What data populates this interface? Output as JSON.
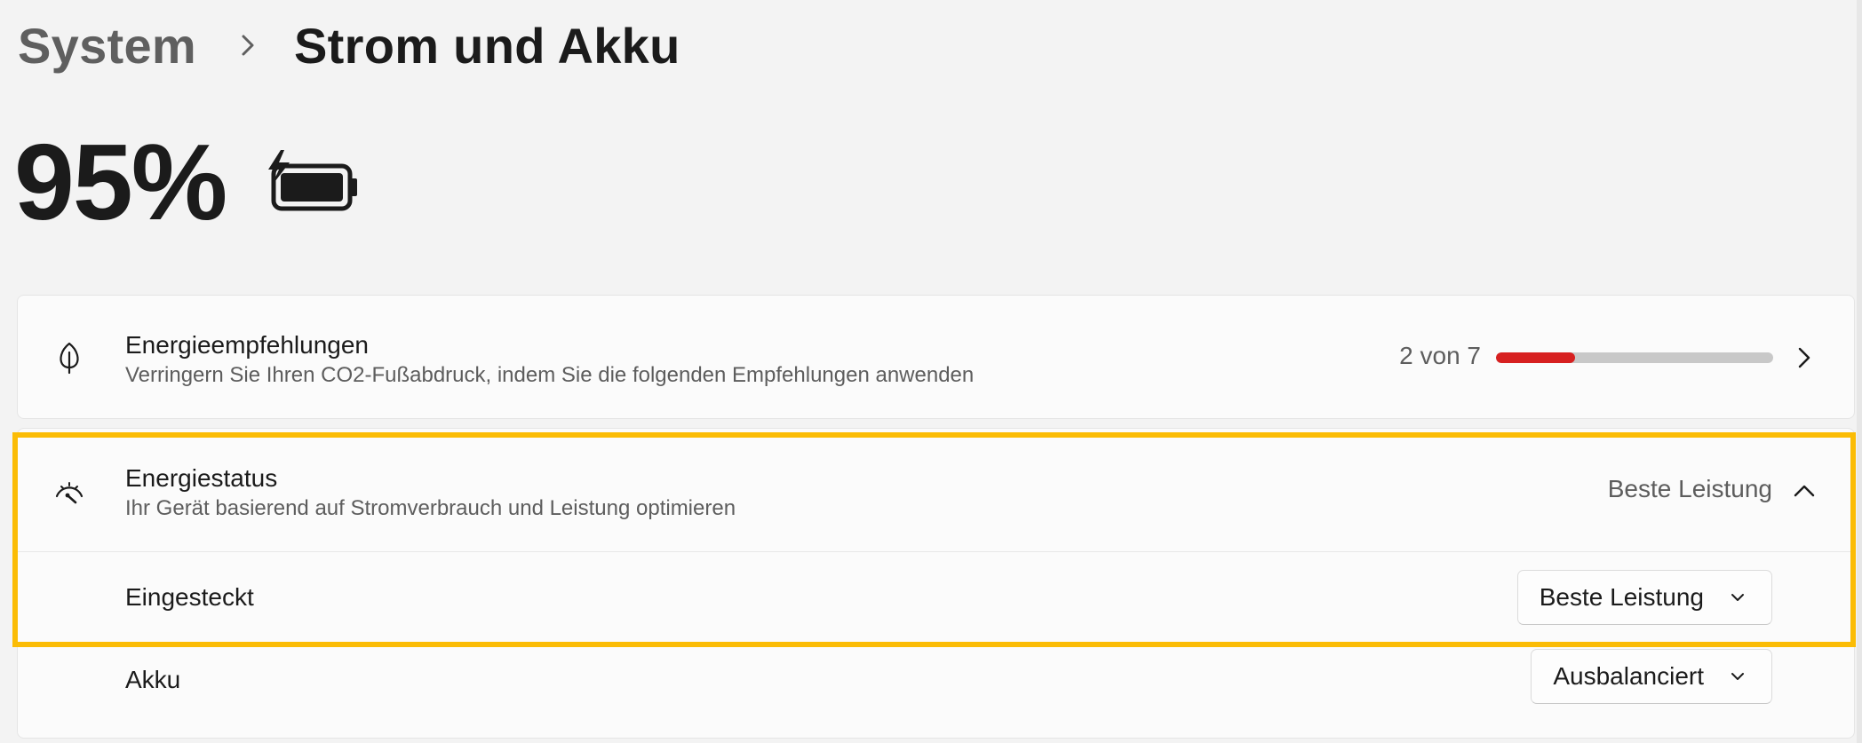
{
  "breadcrumb": {
    "root": "System",
    "current": "Strom und Akku"
  },
  "battery": {
    "percent_text": "95%",
    "charging": true,
    "icon": "battery-charging-icon"
  },
  "recommendations": {
    "title": "Energieempfehlungen",
    "subtitle": "Verringern Sie Ihren CO2-Fußabdruck, indem Sie die folgenden Empfehlungen anwenden",
    "count_text": "2 von 7",
    "progress_fraction": 0.2857,
    "progress_color": "#d72020",
    "icon": "leaf-icon"
  },
  "power_mode": {
    "title": "Energiestatus",
    "subtitle": "Ihr Gerät basierend auf Stromverbrauch und Leistung optimieren",
    "current_value": "Beste Leistung",
    "icon": "gauge-icon",
    "expanded": true,
    "plugged_in": {
      "label": "Eingesteckt",
      "selected": "Beste Leistung"
    },
    "on_battery": {
      "label": "Akku",
      "selected": "Ausbalanciert"
    }
  },
  "colors": {
    "highlight": "#fbbc05",
    "background": "#f3f3f3",
    "card": "#fbfbfb"
  }
}
